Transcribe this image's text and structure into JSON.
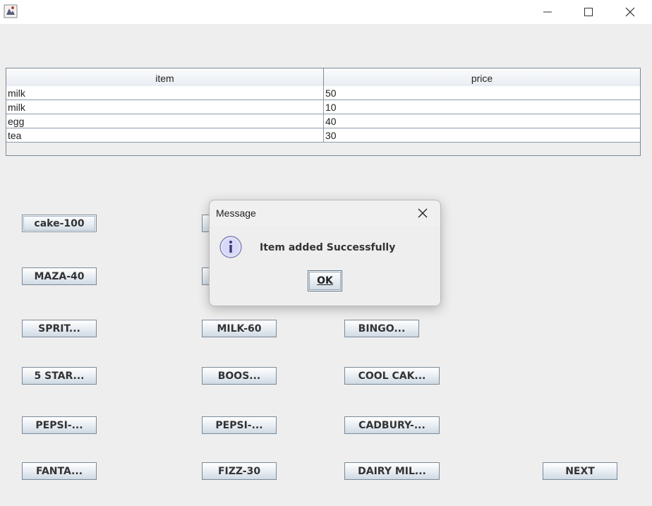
{
  "titlebar": {
    "icons": {
      "app": "java-app-icon",
      "minimize": "minimize-icon",
      "maximize": "maximize-icon",
      "close": "close-icon"
    }
  },
  "table": {
    "headers": [
      "item",
      "price"
    ],
    "rows": [
      [
        "milk",
        "50"
      ],
      [
        "milk",
        "10"
      ],
      [
        "egg",
        "40"
      ],
      [
        "tea",
        "30"
      ]
    ]
  },
  "products": {
    "col1": [
      "cake-100",
      "MAZA-40",
      "SPRIT...",
      "5 STAR...",
      "PEPSI-...",
      "FANTA..."
    ],
    "col2": [
      "MILK-60",
      "BOOS...",
      "PEPSI-...",
      "FIZZ-30"
    ],
    "col3": [
      "BINGO...",
      "COOL CAK...",
      "CADBURY-...",
      "DAIRY MIL..."
    ],
    "next": "NEXT"
  },
  "dialog": {
    "title": "Message",
    "message": "Item added Successfully",
    "ok_label": "OK",
    "icon": "info-icon"
  },
  "colors": {
    "window_bg": "#eeeeee",
    "button_border": "#7a8a99",
    "info_icon_fill": "#d8d8f8"
  }
}
